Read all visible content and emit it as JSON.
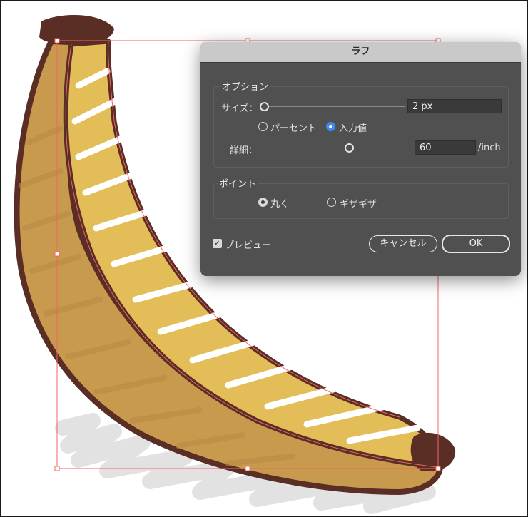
{
  "dialog": {
    "title": "ラフ",
    "options": {
      "group_title": "オプション",
      "size_label": "サイズ：",
      "size_value": "2 px",
      "size_slider_fraction": 0.0,
      "mode_percent_label": "パーセント",
      "mode_absolute_label": "入力値",
      "mode_selected": "absolute",
      "detail_label": "詳細：",
      "detail_value": "60",
      "detail_unit": "/inch",
      "detail_slider_fraction": 0.6
    },
    "points": {
      "group_title": "ポイント",
      "smooth_label": "丸く",
      "corner_label": "ギザギザ",
      "selected": "smooth"
    },
    "preview": {
      "label": "プレビュー",
      "checked": true
    },
    "buttons": {
      "cancel": "キャンセル",
      "ok": "OK"
    }
  },
  "colors": {
    "banana_light": "#e3bd57",
    "banana_dark": "#c79a4e",
    "outline": "#5a2e25",
    "shadow": "#e2e2e2",
    "selection": "#f06565",
    "dialog_bg": "#505050",
    "accent_blue": "#3d8cf4"
  }
}
